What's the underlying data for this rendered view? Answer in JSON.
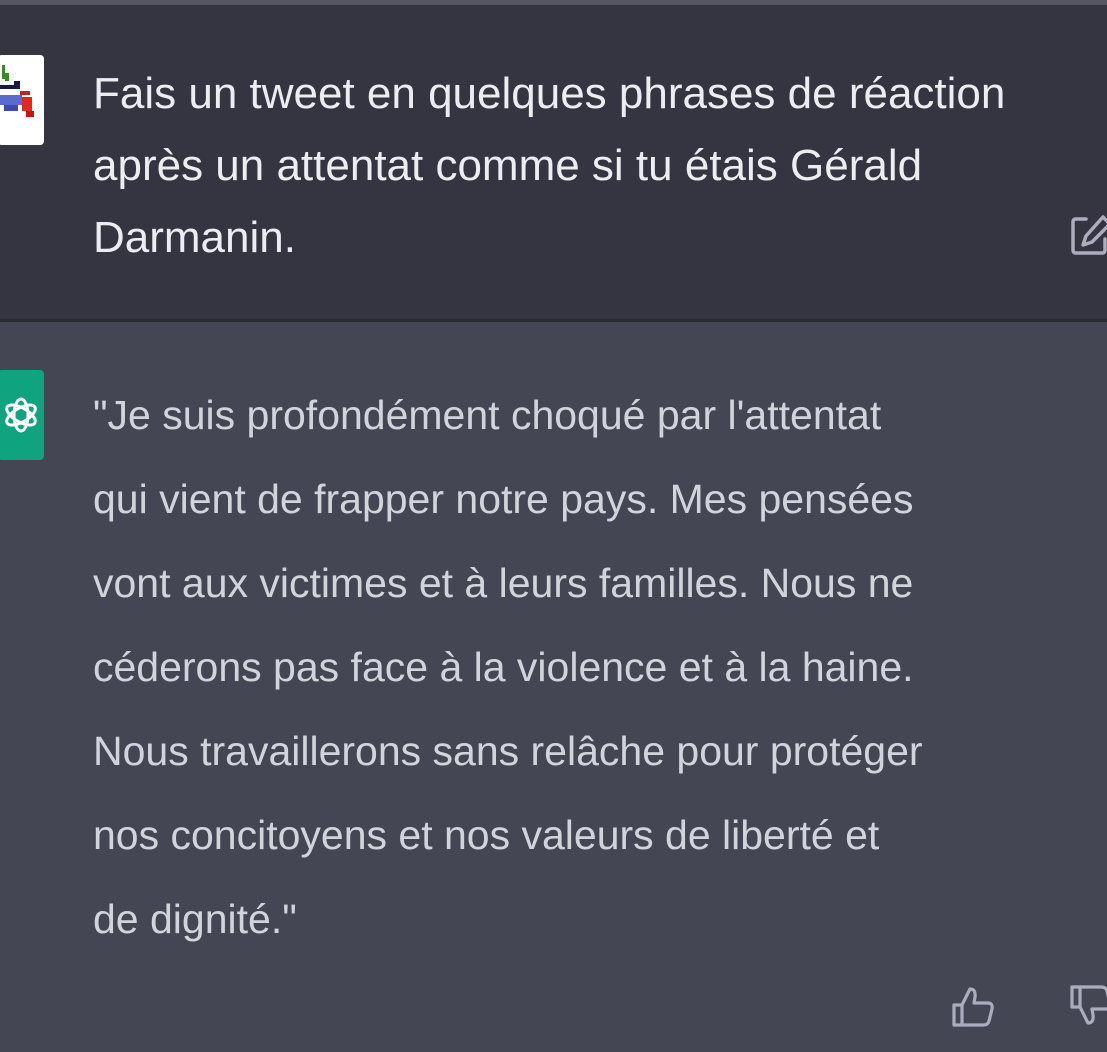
{
  "conversation": {
    "user_message": {
      "text": "Fais un tweet en quelques phrases de réaction après un attentat comme si tu étais Gérald Darmanin.",
      "avatar_icon": "pixel-art-user-avatar-icon",
      "edit_icon": "edit-pencil-icon"
    },
    "assistant_message": {
      "text": "\"Je suis profondément choqué par l'attentat qui vient de frapper notre pays. Mes pensées vont aux victimes et à leurs familles. Nous ne céderons pas face à la violence et à la haine. Nous travaillerons sans relâche pour protéger nos concitoyens et nos valeurs de liberté et de dignité.\"",
      "avatar_icon": "openai-logo-icon",
      "feedback_icons": [
        "thumbs-up-icon",
        "thumbs-down-icon"
      ]
    }
  },
  "colors": {
    "user_bg": "#343541",
    "assistant_bg": "#444654",
    "bot_avatar_bg": "#10a37f",
    "user_text": "#ececf1",
    "assistant_text": "#d1d5db",
    "icon_gray": "#acacbe"
  }
}
